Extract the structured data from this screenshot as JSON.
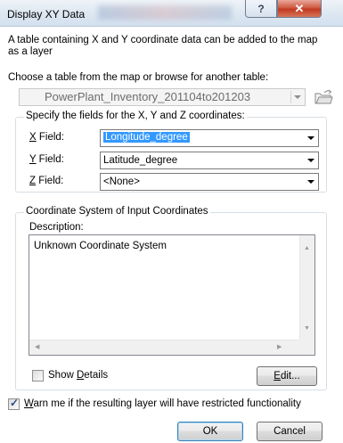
{
  "window": {
    "title": "Display XY Data",
    "help_label": "?",
    "close_label": "✕"
  },
  "intro_text": "A table containing X and Y coordinate data can be added to the map as a layer",
  "choose_label": "Choose a table from the map or browse for another table:",
  "table_combo": {
    "value": "PowerPlant_Inventory_201104to201203"
  },
  "fields_group": {
    "legend": "Specify the fields for the X, Y and Z coordinates:",
    "x": {
      "label_mnemonic": "X",
      "label_rest": " Field:",
      "value": "Longitude_degree"
    },
    "y": {
      "label_mnemonic": "Y",
      "label_rest": " Field:",
      "value": "Latitude_degree"
    },
    "z": {
      "label_mnemonic": "Z",
      "label_rest": " Field:",
      "value": "<None>"
    }
  },
  "coord_group": {
    "legend": "Coordinate System of Input Coordinates",
    "description_label": "Description:",
    "description_text": "Unknown Coordinate System"
  },
  "show_details": {
    "label_pre": "Show ",
    "label_mnemonic": "D",
    "label_post": "etails",
    "checked": false
  },
  "edit_button": {
    "label_mnemonic": "E",
    "label_post": "dit..."
  },
  "warn_checkbox": {
    "label_mnemonic": "W",
    "label_post": "arn me if the resulting layer will have restricted functionality",
    "checked": true
  },
  "ok_button": {
    "label": "OK"
  },
  "cancel_button": {
    "label": "Cancel"
  },
  "icons": {
    "browse": "open-folder-icon",
    "dropdown": "chevron-down-icon",
    "check": "checkmark-icon"
  },
  "colors": {
    "selection": "#3399ff",
    "close_button": "#c13a20",
    "title_bar": "#dbe6f1"
  }
}
